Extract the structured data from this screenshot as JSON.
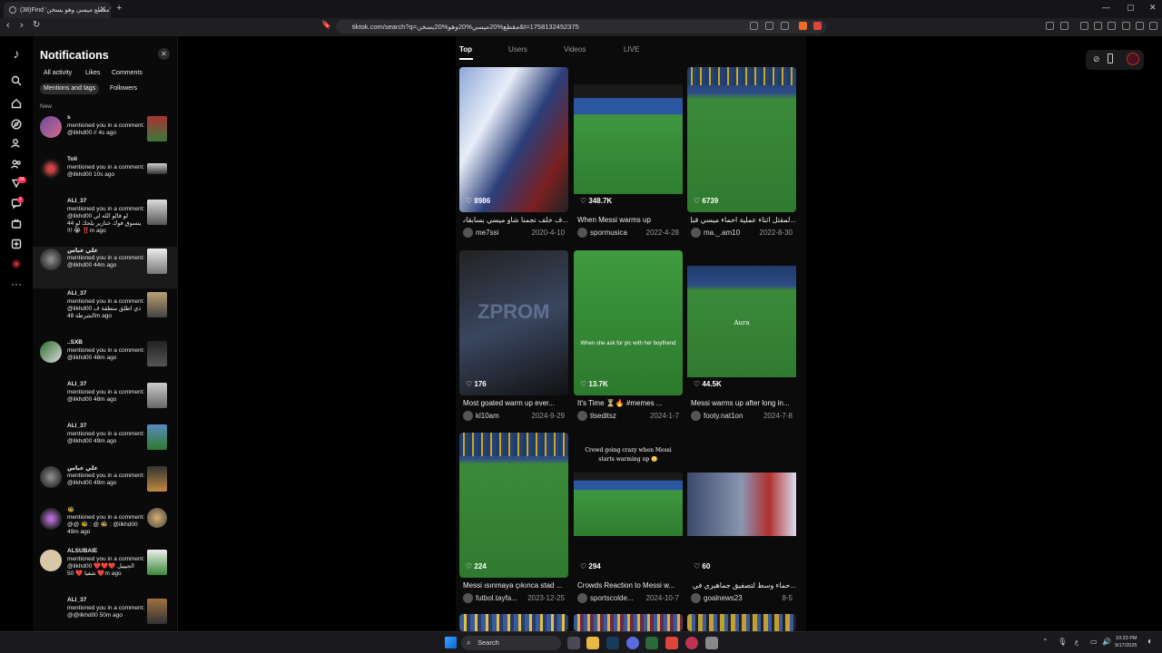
{
  "browser": {
    "tab_title": "(38)Find 'مقطع ميسي وهو يسخن'",
    "url": "tiktok.com/search?q=مقطع%20ميسي%20وهو%20يسخن&t=1758132452375"
  },
  "notifications": {
    "title": "Notifications",
    "filters": [
      "All activity",
      "Likes",
      "Comments",
      "Mentions and tags",
      "Followers"
    ],
    "section_label": "New",
    "items": [
      {
        "name": "s",
        "text": "mentioned you in a comment: @ilkhd00 // 4s ago"
      },
      {
        "name": "Toli",
        "text": "mentioned you in a comment: @ilkhd00 10s ago"
      },
      {
        "name": "ALI_37",
        "text": "mentioned you in a comment: @ilkhd00 لو قالو الله لي يتسوق فوك خنازير يلحك لو 44 !!! 😭 ‼️m ago"
      },
      {
        "name": "علي عباس",
        "text": "mentioned you in a comment: @ilkhd00 44m ago"
      },
      {
        "name": "ALI_37",
        "text": "mentioned you in a comment: @ilkhd00 ذي اطلق منطقة ف الشرطة 48m ago"
      },
      {
        "name": "..SXB",
        "text": "mentioned you in a comment: @ilkhd00 48m ago"
      },
      {
        "name": "ALI_37",
        "text": "mentioned you in a comment: @ilkhd00 48m ago"
      },
      {
        "name": "ALI_37",
        "text": "mentioned you in a comment: @ilkhd00 49m ago"
      },
      {
        "name": "علي عباس",
        "text": "mentioned you in a comment: @ilkhd00 49m ago"
      },
      {
        "name": "🐝",
        "text": "mentioned you in a comment: @@ 🐝 : @ 🐝 : @ilkhd00 49m ago"
      },
      {
        "name": "ALSUBAIE",
        "text": "mentioned you in a comment: @ilkhd00 ❤️❤️❤️ الجيييل شفيا ❤️ 50 ❤️m ago"
      },
      {
        "name": "ALI_37",
        "text": "mentioned you in a comment: @@ilkhd00 50m ago"
      }
    ]
  },
  "search_tabs": [
    "Top",
    "Users",
    "Videos",
    "LIVE"
  ],
  "videos": [
    {
      "likes": "8986",
      "desc": "...ف خلف نجمنا شاو ميسي بسابقات الأحماء",
      "author": "me7ssi",
      "date": "2020-4-10"
    },
    {
      "likes": "348.7K",
      "desc": "When Messi warms up",
      "author": "spormusica",
      "date": "2022-4-28"
    },
    {
      "likes": "6739",
      "desc": "...لمقتل اثناء عملية احماء ميسي قبل الدخول",
      "author": "ma._.am10",
      "date": "2022-8-30"
    },
    {
      "likes": "176",
      "desc": "Most goated warm up ever...",
      "author": "kl10am",
      "date": "2024-9-29"
    },
    {
      "likes": "13.7K",
      "desc": "It's Time ⏳🔥 #memes ...",
      "author": "tlseditsz",
      "date": "2024-1-7"
    },
    {
      "likes": "44.5K",
      "desc": "Messi warms up after long in...",
      "author": "footy.nat1on",
      "date": "2024-7-8"
    },
    {
      "likes": "224",
      "desc": "Messi ısınmaya çıkınca stad ...",
      "author": "futbol.tayfa...",
      "date": "2023-12-25"
    },
    {
      "likes": "294",
      "desc": "Crowds Reaction to Messi w...",
      "author": "sportscolde...",
      "date": "2024-10-7"
    },
    {
      "likes": "60",
      "desc": "...حماء وسط لتصفيق جماهيري في كامب نو",
      "author": "goalnews23",
      "date": "8-5"
    }
  ],
  "video_overlays": {
    "v4": "When she ask for pic with her boyfriend",
    "v5": "Aura",
    "v7": "Crowd going crazy when Messi starts warming up 😳"
  },
  "taskbar": {
    "search_placeholder": "Search",
    "time": "10:23 PM",
    "date": "9/17/2025"
  }
}
